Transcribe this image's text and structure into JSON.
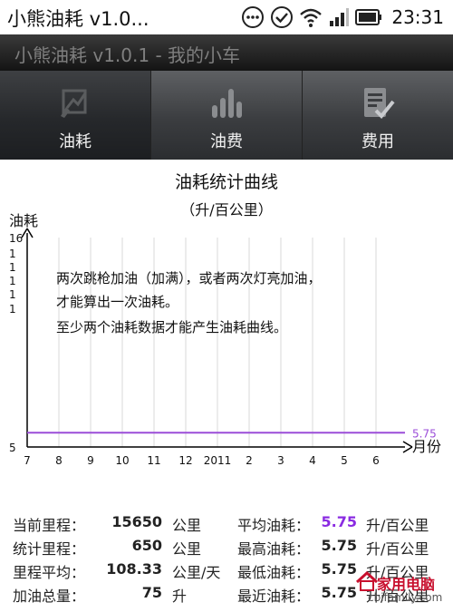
{
  "status_bar": {
    "title": "小熊油耗 v1.0...",
    "time": "23:31",
    "icons": [
      "more-icon",
      "check-circle-icon",
      "wifi-icon",
      "signal-icon",
      "battery-icon"
    ]
  },
  "app": {
    "title": "小熊油耗 v1.0.1 - 我的小车"
  },
  "tabs": [
    {
      "label": "油耗",
      "icon": "edit-chart-icon",
      "active": true
    },
    {
      "label": "油费",
      "icon": "bar-chart-icon",
      "active": false
    },
    {
      "label": "费用",
      "icon": "checklist-icon",
      "active": false
    }
  ],
  "chart_data": {
    "type": "line",
    "title": "油耗统计曲线",
    "subtitle": "（升/百公里）",
    "ylabel": "油耗",
    "xlabel": "月份",
    "categories": [
      "7",
      "8",
      "9",
      "10",
      "11",
      "12",
      "2011",
      "2",
      "3",
      "4",
      "5",
      "6"
    ],
    "ylim": [
      5,
      16
    ],
    "y_tick_labels": [
      "16",
      "1",
      "1",
      "1",
      "1",
      "1",
      "5"
    ],
    "average_line": {
      "value": 5.75,
      "label": "5.75",
      "color": "#9b4dd8"
    },
    "message_lines": [
      "两次跳枪加油（加满），或者两次灯亮加油，",
      "才能算出一次油耗。",
      "至少两个油耗数据才能产生油耗曲线。"
    ],
    "grid": true,
    "colors": {
      "axis": "#000000",
      "grid": "#d8d8d8",
      "avg": "#9b4dd8"
    }
  },
  "stats": {
    "left": [
      {
        "label": "当前里程：",
        "value": "15650",
        "unit": "公里"
      },
      {
        "label": "统计里程：",
        "value": "650",
        "unit": "公里"
      },
      {
        "label": "里程平均：",
        "value": "108.33",
        "unit": "公里/天"
      },
      {
        "label": "加油总量：",
        "value": "75",
        "unit": "升"
      }
    ],
    "right": [
      {
        "label": "平均油耗：",
        "value": "5.75",
        "unit": "升/百公里",
        "highlight": true
      },
      {
        "label": "最高油耗：",
        "value": "5.75",
        "unit": "升/百公里"
      },
      {
        "label": "最低油耗：",
        "value": "5.75",
        "unit": "升/百公里"
      },
      {
        "label": "最近油耗：",
        "value": "5.75",
        "unit": "升/百公里"
      }
    ]
  },
  "watermark": {
    "text": "家用电脑",
    "url": "cbifamily.com"
  }
}
